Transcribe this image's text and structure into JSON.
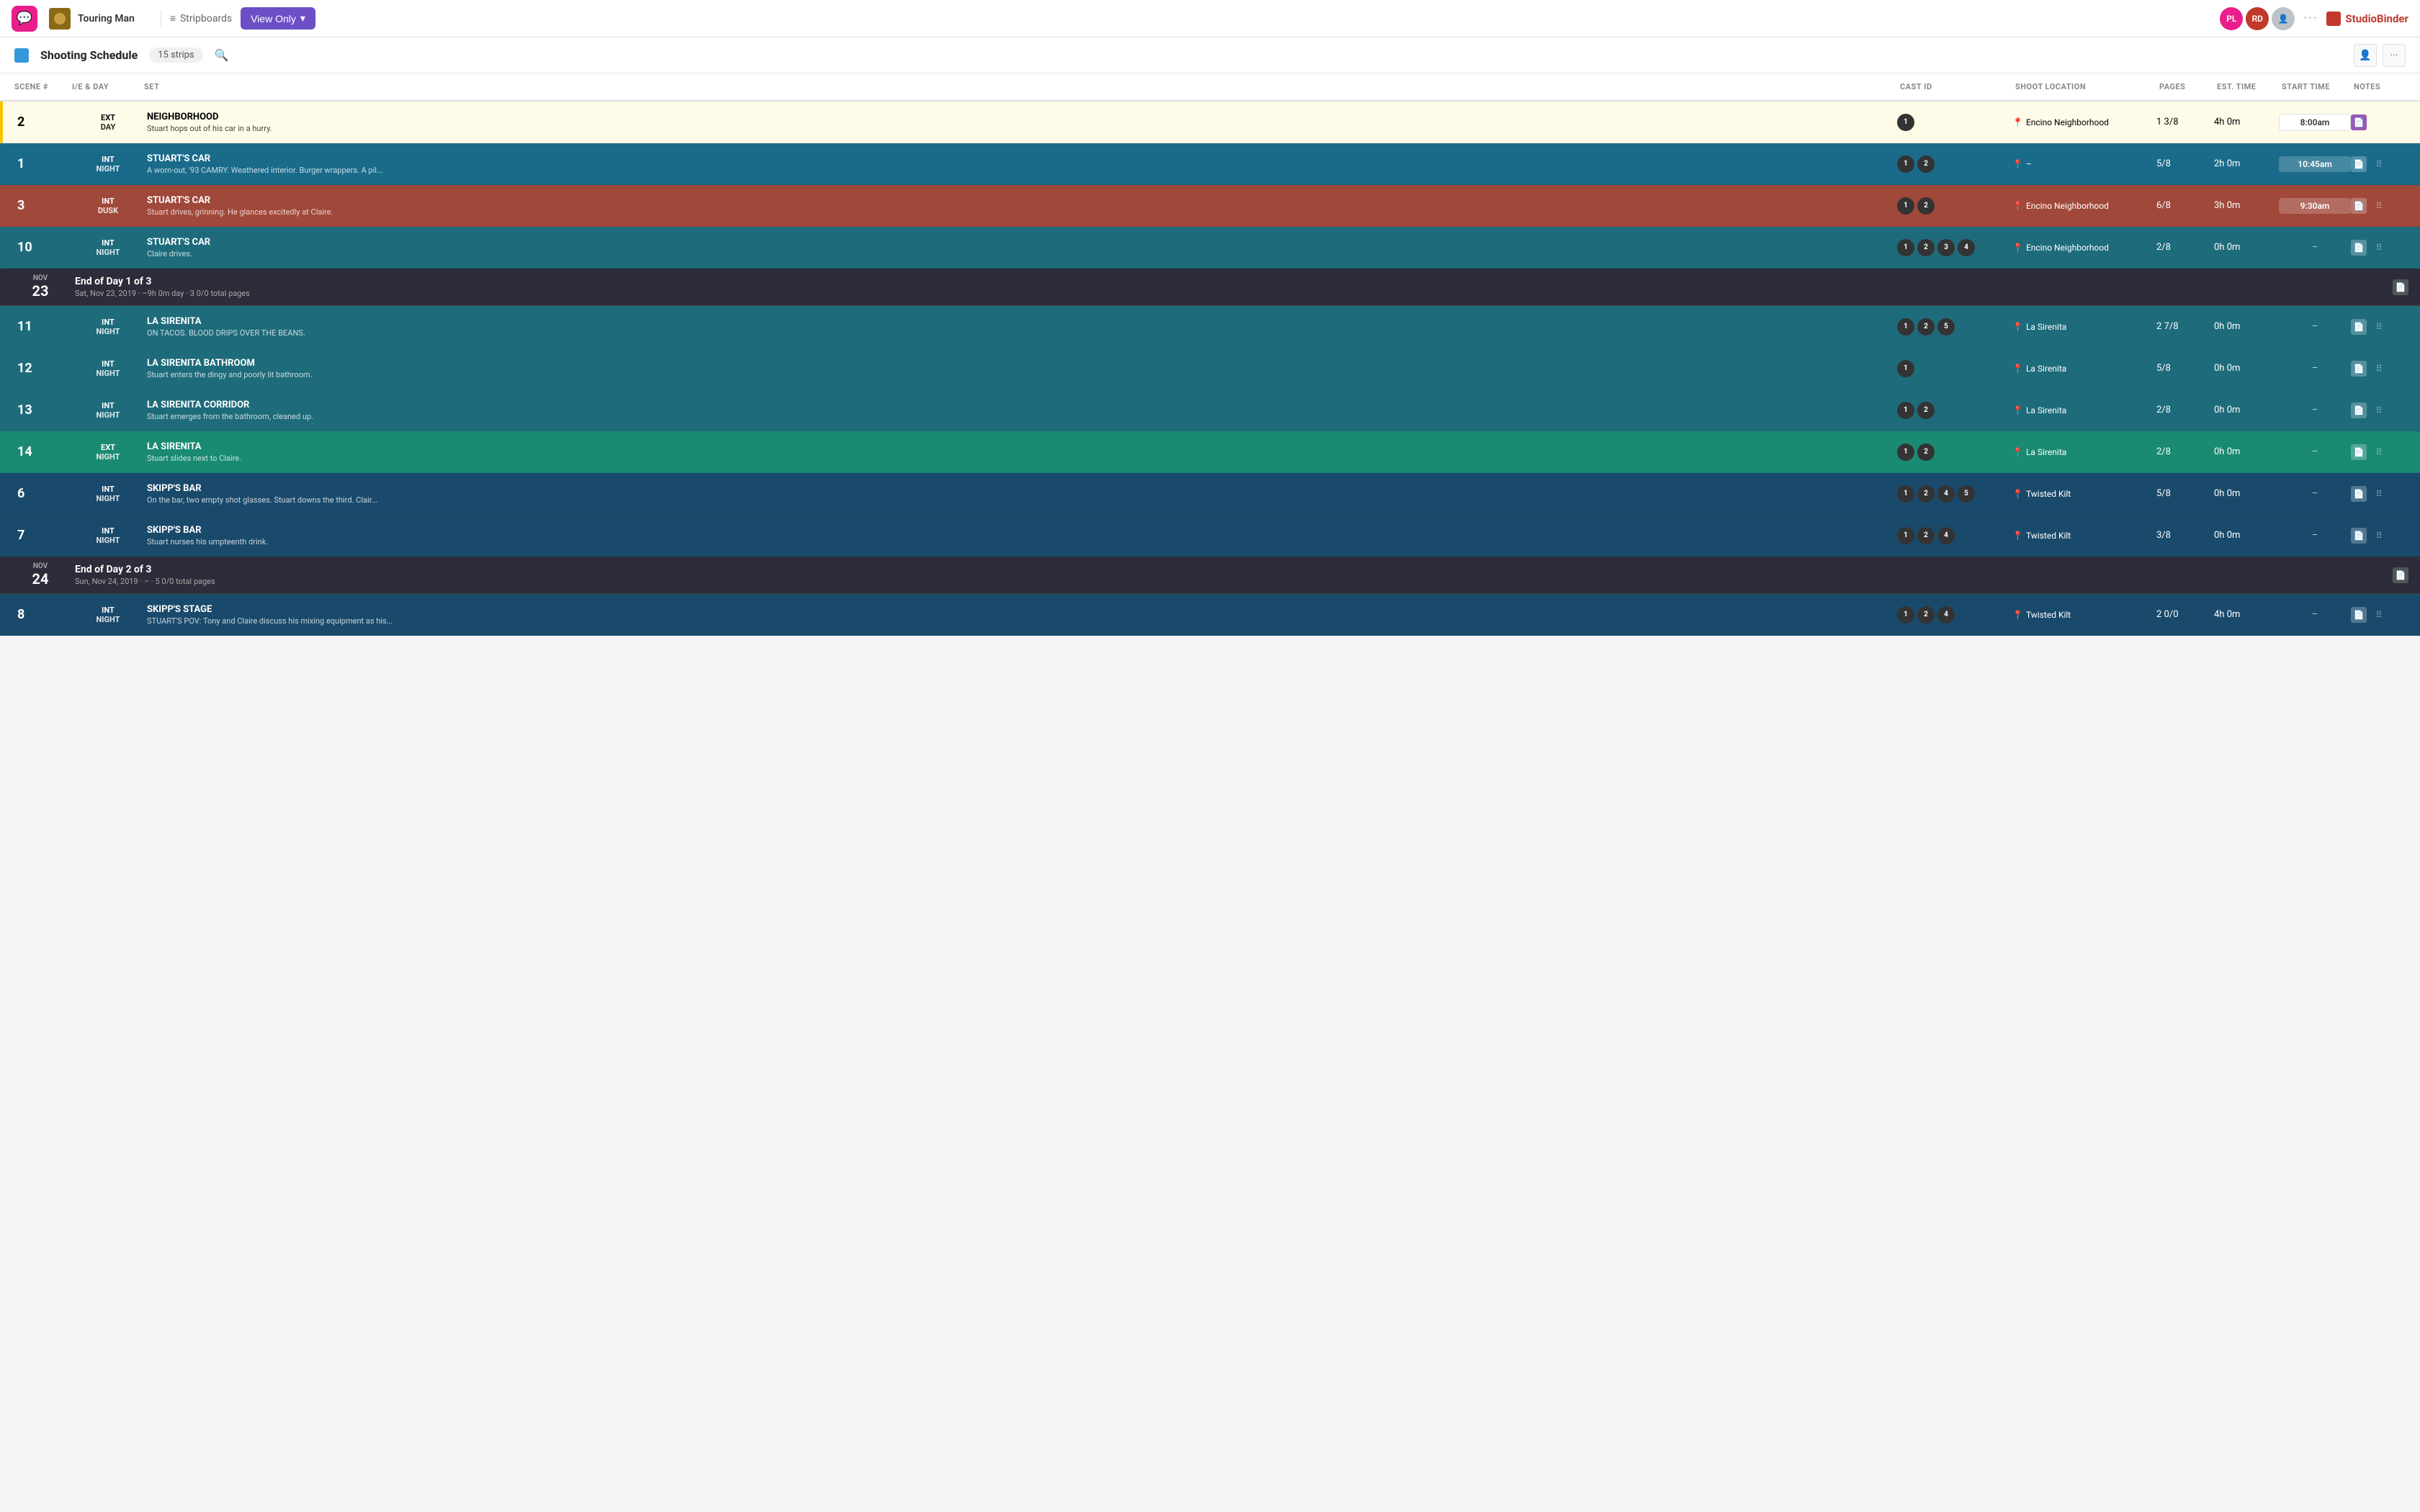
{
  "nav": {
    "logo_icon": "💬",
    "project_name": "Touring Man",
    "stripboards_label": "Stripboards",
    "view_only_label": "View Only",
    "avatars": [
      {
        "initials": "PL",
        "color": "pink"
      },
      {
        "initials": "RD",
        "color": "red"
      },
      {
        "initials": "?",
        "color": "gray"
      }
    ],
    "more_icon": "···",
    "studiobinder_label": "StudioBinder"
  },
  "subheader": {
    "title": "Shooting Schedule",
    "strips_label": "15 strips"
  },
  "columns": [
    "SCENE #",
    "I/E & DAY",
    "SET",
    "CAST ID",
    "SHOOT LOCATION",
    "PAGES",
    "EST. TIME",
    "START TIME",
    "NOTES"
  ],
  "rows": [
    {
      "type": "scene",
      "style": "yellow",
      "scene_num": "2",
      "ie": "EXT",
      "day": "DAY",
      "set_name": "NEIGHBORHOOD",
      "set_desc": "Stuart hops out of his car in a hurry.",
      "cast_ids": [
        "1"
      ],
      "location": "Encino Neighborhood",
      "pages": "1 3/8",
      "est_time": "4h 0m",
      "start_time": "8:00am",
      "start_time_style": "yellow-bg"
    },
    {
      "type": "scene",
      "style": "blue",
      "scene_num": "1",
      "ie": "INT",
      "day": "NIGHT",
      "set_name": "STUART'S CAR",
      "set_desc": "A worn-out, '93 CAMRY. Weathered interior. Burger wrappers. A pil...",
      "cast_ids": [
        "1",
        "2"
      ],
      "location": "–",
      "pages": "5/8",
      "est_time": "2h 0m",
      "start_time": "10:45am",
      "start_time_style": "white"
    },
    {
      "type": "scene",
      "style": "brown",
      "scene_num": "3",
      "ie": "INT",
      "day": "DUSK",
      "set_name": "STUART'S CAR",
      "set_desc": "Stuart drives, grinning. He glances excitedly at Claire.",
      "cast_ids": [
        "1",
        "2"
      ],
      "location": "Encino Neighborhood",
      "pages": "6/8",
      "est_time": "3h 0m",
      "start_time": "9:30am",
      "start_time_style": "white"
    },
    {
      "type": "scene",
      "style": "dark-teal",
      "scene_num": "10",
      "ie": "INT",
      "day": "NIGHT",
      "set_name": "STUART'S CAR",
      "set_desc": "Claire drives.",
      "cast_ids": [
        "1",
        "2",
        "3",
        "4"
      ],
      "location": "Encino Neighborhood",
      "pages": "2/8",
      "est_time": "0h 0m",
      "start_time": "–",
      "start_time_style": "dash"
    },
    {
      "type": "eod",
      "month": "NOV",
      "day": "23",
      "title": "End of Day 1 of 3",
      "subtitle": "Sat, Nov 23, 2019  ·  –9h 0m day  ·  3 0/0 total pages"
    },
    {
      "type": "scene",
      "style": "dark-teal",
      "scene_num": "11",
      "ie": "INT",
      "day": "NIGHT",
      "set_name": "LA SIRENITA",
      "set_desc": "ON TACOS. BLOOD DRIPS OVER THE BEANS.",
      "cast_ids": [
        "1",
        "2",
        "5"
      ],
      "location": "La Sirenita",
      "pages": "2 7/8",
      "est_time": "0h 0m",
      "start_time": "–",
      "start_time_style": "dash"
    },
    {
      "type": "scene",
      "style": "dark-teal",
      "scene_num": "12",
      "ie": "INT",
      "day": "NIGHT",
      "set_name": "LA SIRENITA BATHROOM",
      "set_desc": "Stuart enters the dingy and poorly lit bathroom.",
      "cast_ids": [
        "1"
      ],
      "location": "La Sirenita",
      "pages": "5/8",
      "est_time": "0h 0m",
      "start_time": "–",
      "start_time_style": "dash"
    },
    {
      "type": "scene",
      "style": "dark-teal",
      "scene_num": "13",
      "ie": "INT",
      "day": "NIGHT",
      "set_name": "LA SIRENITA CORRIDOR",
      "set_desc": "Stuart emerges from the bathroom, cleaned up.",
      "cast_ids": [
        "1",
        "2"
      ],
      "location": "La Sirenita",
      "pages": "2/8",
      "est_time": "0h 0m",
      "start_time": "–",
      "start_time_style": "dash"
    },
    {
      "type": "scene",
      "style": "teal",
      "scene_num": "14",
      "ie": "EXT",
      "day": "NIGHT",
      "set_name": "LA SIRENITA",
      "set_desc": "Stuart slides next to Claire.",
      "cast_ids": [
        "1",
        "2"
      ],
      "location": "La Sirenita",
      "pages": "2/8",
      "est_time": "0h 0m",
      "start_time": "–",
      "start_time_style": "dash"
    },
    {
      "type": "scene",
      "style": "dark-blue",
      "scene_num": "6",
      "ie": "INT",
      "day": "NIGHT",
      "set_name": "SKIPP'S BAR",
      "set_desc": "On the bar, two empty shot glasses. Stuart downs the third. Clair...",
      "cast_ids": [
        "1",
        "2",
        "4",
        "5"
      ],
      "location": "Twisted Kilt",
      "pages": "5/8",
      "est_time": "0h 0m",
      "start_time": "–",
      "start_time_style": "dash"
    },
    {
      "type": "scene",
      "style": "dark-blue",
      "scene_num": "7",
      "ie": "INT",
      "day": "NIGHT",
      "set_name": "SKIPP'S BAR",
      "set_desc": "Stuart nurses his umpteenth drink.",
      "cast_ids": [
        "1",
        "2",
        "4"
      ],
      "location": "Twisted Kilt",
      "pages": "3/8",
      "est_time": "0h 0m",
      "start_time": "–",
      "start_time_style": "dash"
    },
    {
      "type": "eod",
      "month": "NOV",
      "day": "24",
      "title": "End of Day 2 of 3",
      "subtitle": "Sun, Nov 24, 2019  ·  –  ·  5 0/0 total pages"
    },
    {
      "type": "scene",
      "style": "dark-blue",
      "scene_num": "8",
      "ie": "INT",
      "day": "NIGHT",
      "set_name": "SKIPP'S STAGE",
      "set_desc": "STUART'S POV: Tony and Claire discuss his mixing equipment as his...",
      "cast_ids": [
        "1",
        "2",
        "4"
      ],
      "location": "Twisted Kilt",
      "pages": "2 0/0",
      "est_time": "4h 0m",
      "start_time": "–",
      "start_time_style": "dash"
    }
  ]
}
